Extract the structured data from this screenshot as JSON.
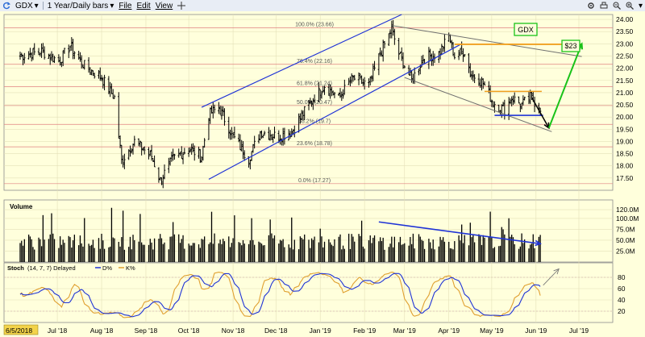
{
  "toolbar": {
    "symbol": "GDX",
    "timeframe": "1 Year/Daily bars",
    "menu": [
      "File",
      "Edit",
      "View"
    ],
    "icons": [
      "refresh-icon",
      "symbol-dropdown-icon",
      "timeframe-dropdown-icon",
      "crosshair-icon",
      "settings-icon",
      "print-icon",
      "zoom-out-icon",
      "zoom-in-icon",
      "options-dropdown-icon"
    ]
  },
  "colors": {
    "background": "#ffffdc",
    "up_bar": "#000000",
    "channel_lines": "#1f33d6",
    "trend_lines": "#707070",
    "orange_lines": "#f0a020",
    "fib_lines": "#e08080",
    "green_arrow": "#19c219",
    "stoch_d": "#1f33d6",
    "stoch_k": "#e0a030"
  },
  "chart_data": [
    {
      "type": "candlestick",
      "panel": "price",
      "ylim": [
        17.0,
        24.2
      ],
      "y_ticks": [
        "24.00",
        "23.50",
        "23.00",
        "22.50",
        "22.00",
        "21.50",
        "21.00",
        "20.50",
        "20.00",
        "19.50",
        "19.00",
        "18.50",
        "18.00",
        "17.50"
      ],
      "x_tick_labels": [
        "6/5/2018",
        "Jul '18",
        "Aug '18",
        "Sep '18",
        "Oct '18",
        "Nov '18",
        "Dec '18",
        "Jan '19",
        "Feb '19",
        "Mar '19",
        "Apr '19",
        "May '19",
        "Jun '19",
        "Jul '19"
      ],
      "fibonacci": [
        {
          "label": "100.0% (23.66)",
          "value": 23.66
        },
        {
          "label": "76.4% (22.16)",
          "value": 22.16
        },
        {
          "label": "61.8% (21.24)",
          "value": 21.24
        },
        {
          "label": "50.0% (20.47)",
          "value": 20.47
        },
        {
          "label": "38.2% (19.7)",
          "value": 19.7
        },
        {
          "label": "23.6% (18.78)",
          "value": 18.78
        },
        {
          "label": "0.0% (17.27)",
          "value": 17.27
        }
      ],
      "annotations": {
        "badge_gdx": "GDX",
        "badge_target": "$23"
      },
      "price_path_anchors": [
        {
          "date": "2018-06-05",
          "close": 22.5
        },
        {
          "date": "2018-06-20",
          "close": 22.7
        },
        {
          "date": "2018-07-02",
          "close": 22.3
        },
        {
          "date": "2018-07-10",
          "close": 22.9
        },
        {
          "date": "2018-07-20",
          "close": 22.1
        },
        {
          "date": "2018-08-01",
          "close": 21.6
        },
        {
          "date": "2018-08-10",
          "close": 20.8
        },
        {
          "date": "2018-08-15",
          "close": 18.2
        },
        {
          "date": "2018-08-24",
          "close": 19.0
        },
        {
          "date": "2018-09-05",
          "close": 18.4
        },
        {
          "date": "2018-09-11",
          "close": 17.4
        },
        {
          "date": "2018-09-20",
          "close": 18.3
        },
        {
          "date": "2018-10-01",
          "close": 18.7
        },
        {
          "date": "2018-10-10",
          "close": 18.4
        },
        {
          "date": "2018-10-15",
          "close": 20.1
        },
        {
          "date": "2018-10-22",
          "close": 20.4
        },
        {
          "date": "2018-11-01",
          "close": 19.2
        },
        {
          "date": "2018-11-12",
          "close": 18.3
        },
        {
          "date": "2018-11-20",
          "close": 19.4
        },
        {
          "date": "2018-12-03",
          "close": 19.2
        },
        {
          "date": "2018-12-12",
          "close": 19.4
        },
        {
          "date": "2018-12-24",
          "close": 20.5
        },
        {
          "date": "2019-01-04",
          "close": 21.3
        },
        {
          "date": "2019-01-14",
          "close": 20.8
        },
        {
          "date": "2019-01-24",
          "close": 21.6
        },
        {
          "date": "2019-02-04",
          "close": 21.3
        },
        {
          "date": "2019-02-12",
          "close": 22.6
        },
        {
          "date": "2019-02-20",
          "close": 23.6
        },
        {
          "date": "2019-02-25",
          "close": 22.6
        },
        {
          "date": "2019-03-06",
          "close": 21.5
        },
        {
          "date": "2019-03-14",
          "close": 22.4
        },
        {
          "date": "2019-03-25",
          "close": 22.6
        },
        {
          "date": "2019-04-01",
          "close": 23.3
        },
        {
          "date": "2019-04-05",
          "close": 22.5
        },
        {
          "date": "2019-04-12",
          "close": 22.7
        },
        {
          "date": "2019-04-16",
          "close": 21.8
        },
        {
          "date": "2019-04-25",
          "close": 21.4
        },
        {
          "date": "2019-05-02",
          "close": 20.6
        },
        {
          "date": "2019-05-10",
          "close": 20.3
        },
        {
          "date": "2019-05-15",
          "close": 20.8
        },
        {
          "date": "2019-05-22",
          "close": 20.5
        },
        {
          "date": "2019-05-28",
          "close": 20.8
        },
        {
          "date": "2019-06-04",
          "close": 20.4
        }
      ],
      "channel_upper": [
        {
          "date": "2018-10-10",
          "value": 20.4
        },
        {
          "date": "2019-02-27",
          "value": 24.2
        }
      ],
      "channel_lower": [
        {
          "date": "2018-10-15",
          "value": 17.45
        },
        {
          "date": "2019-04-10",
          "value": 23.0
        }
      ],
      "trend_upper": [
        {
          "date": "2019-02-20",
          "value": 23.75
        },
        {
          "date": "2019-07-03",
          "value": 22.48
        }
      ],
      "trend_lower": [
        {
          "date": "2019-03-01",
          "value": 21.62
        },
        {
          "date": "2019-06-12",
          "value": 19.4
        }
      ],
      "orange_resistance": [
        {
          "date": "2019-04-05",
          "value": 22.98
        },
        {
          "date": "2019-07-03",
          "value": 22.98
        }
      ],
      "orange_box_top": [
        {
          "date": "2019-04-26",
          "value": 21.05
        },
        {
          "date": "2019-06-05",
          "value": 21.05
        }
      ],
      "blue_box_bottom": [
        {
          "date": "2019-05-03",
          "value": 20.07
        },
        {
          "date": "2019-06-06",
          "value": 20.07
        }
      ],
      "black_arrow": [
        {
          "date": "2019-05-29",
          "value": 20.8
        },
        {
          "date": "2019-06-10",
          "value": 19.55
        }
      ],
      "green_arrow": [
        {
          "date": "2019-06-10",
          "value": 19.55
        },
        {
          "date": "2019-07-03",
          "value": 23.0
        }
      ]
    },
    {
      "type": "bar",
      "panel": "volume",
      "title": "Volume",
      "ylim": [
        0,
        135
      ],
      "y_ticks": [
        "120.0M",
        "100.0M",
        "75.0M",
        "50.0M",
        "25.0M"
      ],
      "trend_line": [
        {
          "date": "2019-02-11",
          "value": 92
        },
        {
          "date": "2019-06-04",
          "value": 42
        }
      ]
    },
    {
      "type": "line",
      "panel": "stochastic",
      "title": "Stoch",
      "params": "(14, 7, 7) Delayed",
      "series_labels": [
        "D%",
        "K%"
      ],
      "ylim": [
        0,
        100
      ],
      "y_ticks": [
        "80",
        "60",
        "40",
        "20"
      ],
      "reference_levels": [
        20,
        80
      ],
      "stoch_arrow": [
        {
          "date": "2019-06-06",
          "value": 66
        },
        {
          "date": "2019-06-17",
          "value": 95
        }
      ]
    }
  ]
}
